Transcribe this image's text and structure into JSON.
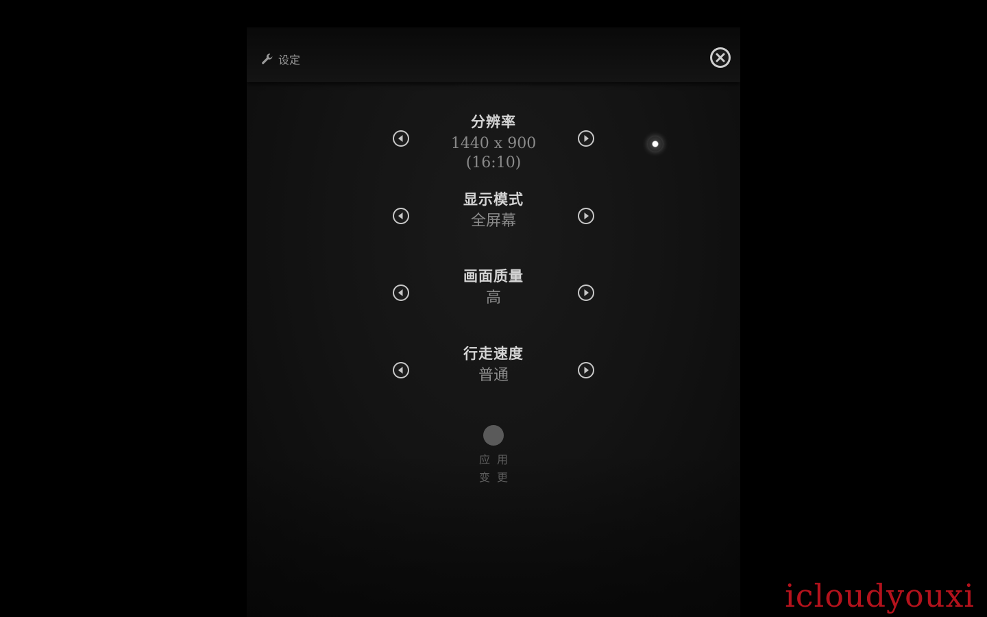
{
  "header": {
    "title": "设定",
    "icon": "wrench-icon",
    "close_icon": "close-icon"
  },
  "settings": [
    {
      "label": "分辨率",
      "value": "1440 x 900",
      "value_sub": "(16:10)"
    },
    {
      "label": "显示模式",
      "value": "全屏幕"
    },
    {
      "label": "画面质量",
      "value": "高"
    },
    {
      "label": "行走速度",
      "value": "普通"
    }
  ],
  "apply": {
    "line1": "应用",
    "line2": "变更"
  },
  "watermark": "icloudyouxi",
  "colors": {
    "background": "#000000",
    "panel": "#141414",
    "label": "#d4d4d4",
    "value": "#8a8a8a",
    "watermark": "#b4121c"
  }
}
